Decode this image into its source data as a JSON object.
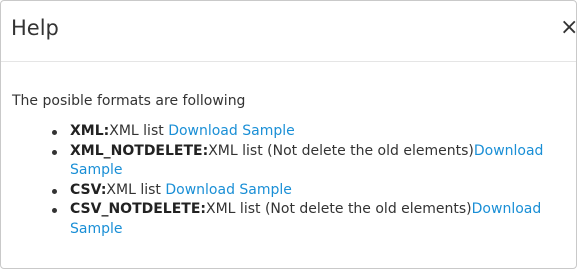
{
  "dialog": {
    "title": "Help",
    "close_label": "×",
    "intro": "The posible formats are following",
    "formats": [
      {
        "name": "XML:",
        "desc": "XML list ",
        "link": "Download Sample"
      },
      {
        "name": "XML_NOTDELETE:",
        "desc": "XML list (Not delete the old elements)",
        "link": "Download Sample"
      },
      {
        "name": "CSV:",
        "desc": "XML list ",
        "link": "Download Sample"
      },
      {
        "name": "CSV_NOTDELETE:",
        "desc": "XML list (Not delete the old elements)",
        "link": "Download Sample"
      }
    ]
  },
  "colors": {
    "link": "#1a8fd6",
    "text": "#333333",
    "border": "#c9c9c9"
  }
}
